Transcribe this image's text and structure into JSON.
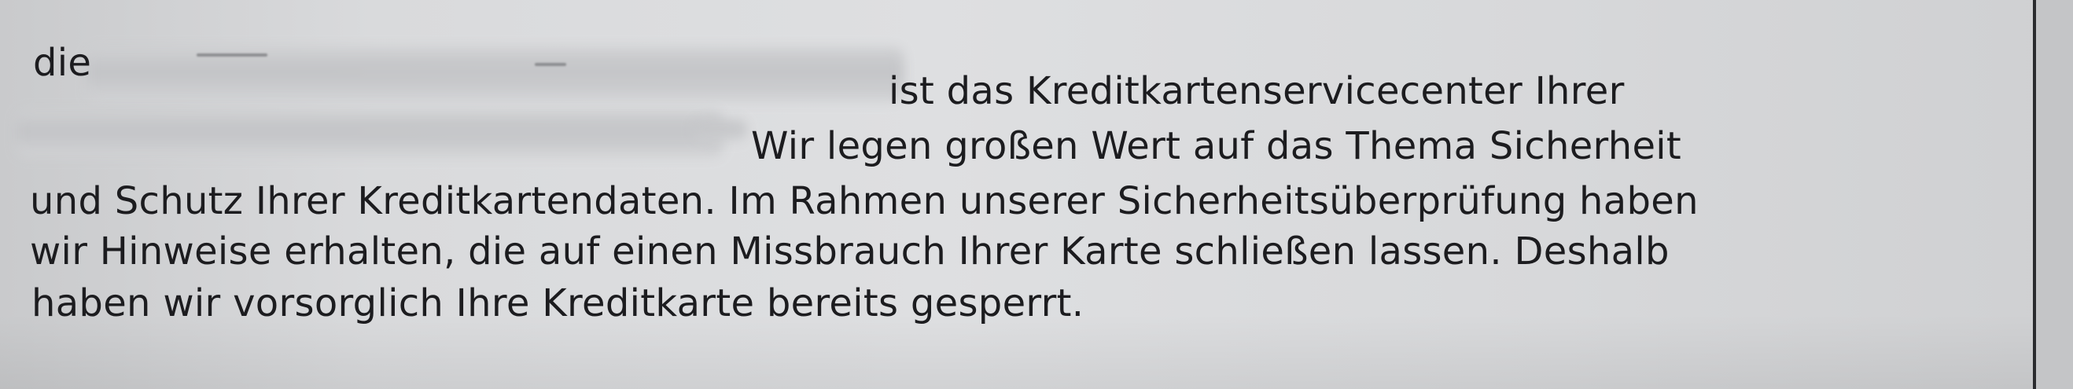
{
  "document": {
    "line1_start": "die",
    "line1_end": "ist das Kreditkartenservicecenter Ihrer",
    "line2_end": "Wir legen großen Wert auf das Thema Sicherheit",
    "line3": "und Schutz Ihrer Kreditkartendaten. Im Rahmen unserer Sicherheitsüberprüfung haben",
    "line4": "wir Hinweise erhalten, die auf einen Missbrauch Ihrer Karte schließen lassen. Deshalb",
    "line5": "haben wir vorsorglich Ihre Kreditkarte bereits gesperrt."
  },
  "colors": {
    "paper": "#dedfe1",
    "text": "#1c1c1f",
    "redaction": "#c2c3c6"
  }
}
